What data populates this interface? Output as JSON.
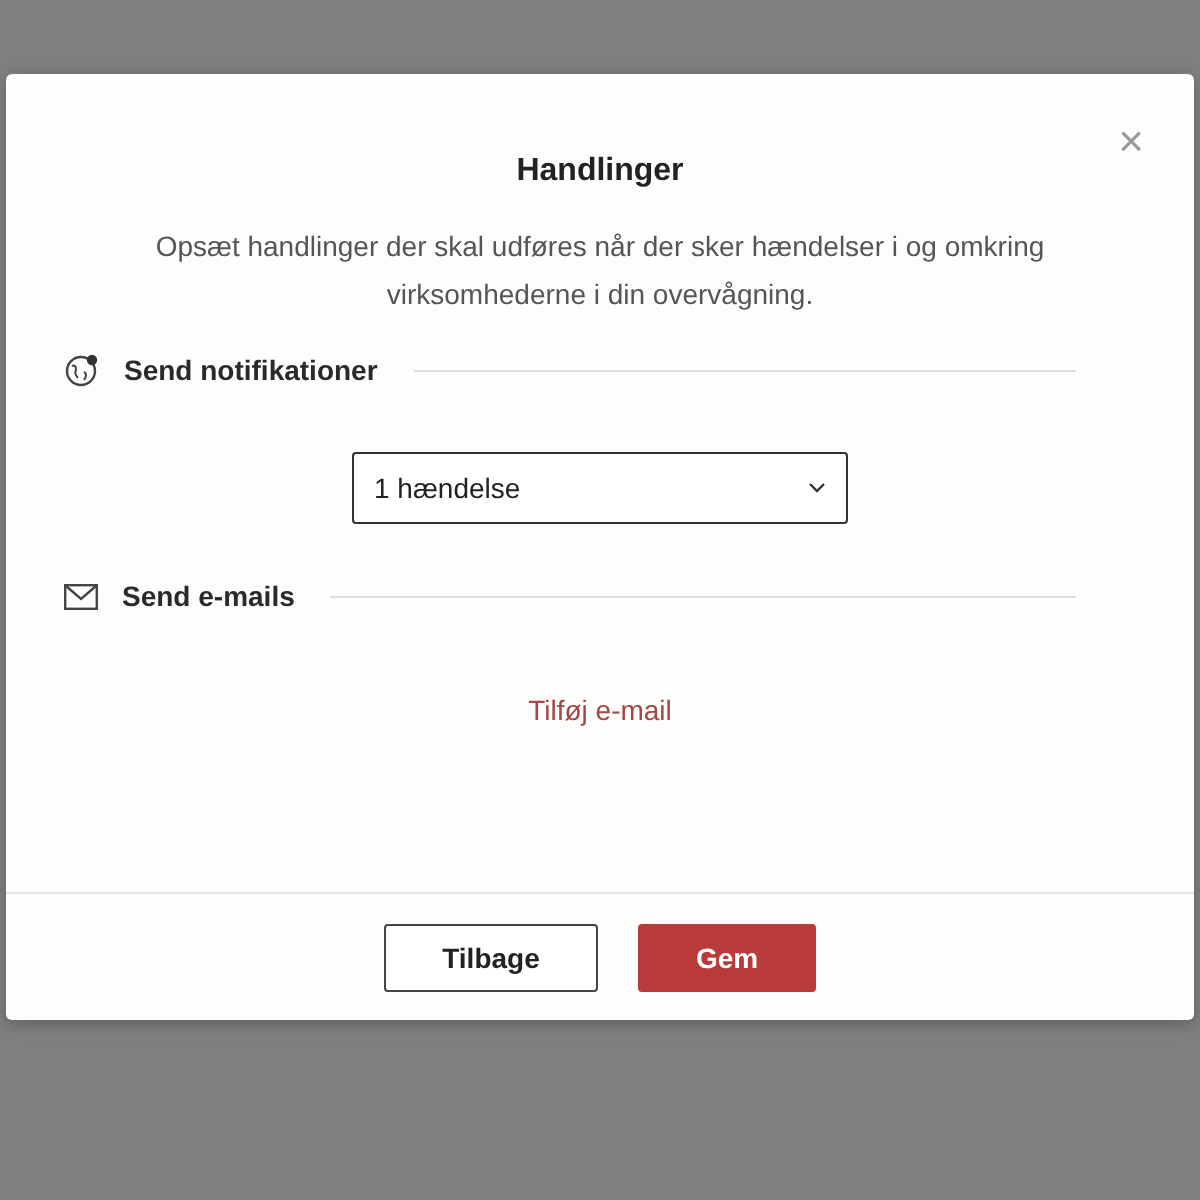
{
  "dialog": {
    "title": "Handlinger",
    "description": "Opsæt handlinger der skal udføres når der sker hændelser i og omkring virksomhederne i din overvågning.",
    "close": "×"
  },
  "sections": [
    {
      "kind": "notifications",
      "title": "Send notifikationer",
      "select": {
        "value": "1 hændelse"
      }
    },
    {
      "kind": "emails",
      "title": "Send e-mails",
      "link": "Tilføj e-mail"
    }
  ],
  "buttons": [
    {
      "label": "Tilbage",
      "kind": "secondary"
    },
    {
      "label": "Gem",
      "kind": "primary"
    }
  ]
}
